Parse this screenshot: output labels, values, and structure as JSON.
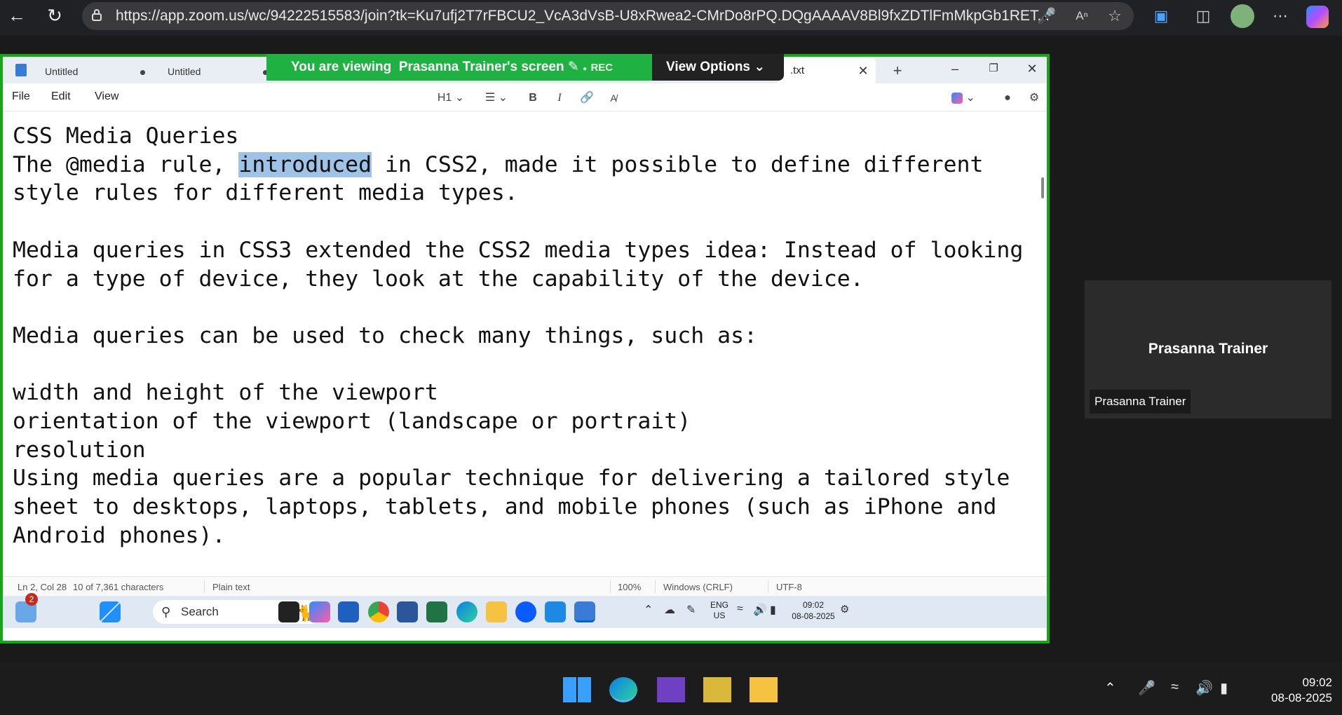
{
  "browser": {
    "url": "https://app.zoom.us/wc/94222515583/join?tk=Ku7ufj2T7rFBCU2_VcA3dVsB-U8xRwea2-CMrDo8rPQ.DQgAAAAV8Bl9fxZDTlFmMkpGb1RET..."
  },
  "zoom": {
    "banner_prefix": "You are viewing",
    "banner_name": "Prasanna Trainer's screen",
    "rec_label": "REC",
    "view_options": "View Options",
    "participant_name": "Prasanna Trainer",
    "participant_label": "Prasanna Trainer",
    "accent": "#1fb141",
    "frame_color": "#19a519"
  },
  "notepad": {
    "tabs": [
      "Untitled",
      "Untitled"
    ],
    "active_tab": ".txt",
    "menu": [
      "File",
      "Edit",
      "View"
    ],
    "heading_select": "H1",
    "editor": {
      "line1": "CSS Media Queries",
      "line2_a": "The @media rule, ",
      "line2_sel": "introduced",
      "line2_b": " in CSS2, made it possible to define different",
      "line3": "style rules for different media types.",
      "line4": "",
      "line5": "Media queries in CSS3 extended the CSS2 media types idea: Instead of looking",
      "line6": "for a type of device, they look at the capability of the device.",
      "line7": "",
      "line8": "Media queries can be used to check many things, such as:",
      "line9": "",
      "line10": "width and height of the viewport",
      "line11": "orientation of the viewport (landscape or portrait)",
      "line12": "resolution",
      "line13": "Using media queries are a popular technique for delivering a tailored style",
      "line14": "sheet to desktops, laptops, tablets, and mobile phones (such as iPhone and",
      "line15": "Android phones)."
    },
    "status": {
      "position": "Ln 2, Col 28",
      "chars": "10 of 7,361 characters",
      "format": "Plain text",
      "zoom": "100%",
      "line_ending": "Windows (CRLF)",
      "encoding": "UTF-8"
    }
  },
  "inner_taskbar": {
    "search_placeholder": "Search",
    "badge": "2",
    "lang1": "ENG",
    "lang2": "US",
    "time": "09:02",
    "date": "08-08-2025"
  },
  "os_taskbar": {
    "time": "09:02",
    "date": "08-08-2025"
  }
}
